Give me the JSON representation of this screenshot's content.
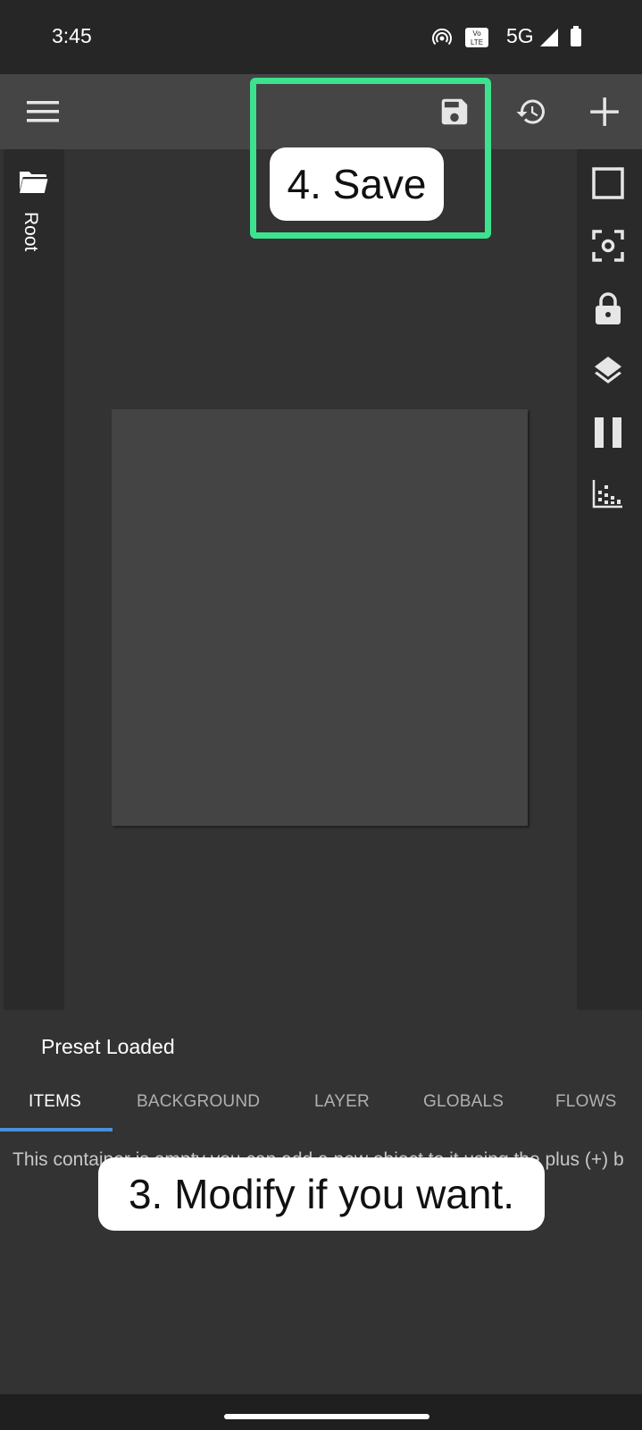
{
  "status_bar": {
    "time": "3:45",
    "network": "5G",
    "icons": [
      "hotspot-icon",
      "volte-icon",
      "signal-icon",
      "battery-icon"
    ]
  },
  "toolbar": {
    "icons": [
      "menu-icon",
      "save-icon",
      "history-icon",
      "add-icon"
    ]
  },
  "left_panel": {
    "folder_label": "Root",
    "icons": [
      "folder-icon"
    ]
  },
  "right_panel": {
    "icons": [
      "square-icon",
      "focus-icon",
      "lock-icon",
      "layers-icon",
      "pause-icon",
      "chart-icon"
    ]
  },
  "bottom_panel": {
    "preset_status": "Preset Loaded",
    "tabs": [
      {
        "label": "ITEMS",
        "active": true
      },
      {
        "label": "BACKGROUND",
        "active": false
      },
      {
        "label": "LAYER",
        "active": false
      },
      {
        "label": "GLOBALS",
        "active": false
      },
      {
        "label": "FLOWS",
        "active": false
      }
    ],
    "empty_message": "This container is empty you can add a new object to it using the plus (+) b"
  },
  "annotations": {
    "save_callout": "4. Save",
    "modify_callout": "3. Modify if you want."
  },
  "colors": {
    "highlight": "#3de28f",
    "tab_indicator": "#4a90d9",
    "toolbar_bg": "#454545",
    "panel_bg": "#2a2a2a",
    "canvas_bg": "#444444"
  }
}
